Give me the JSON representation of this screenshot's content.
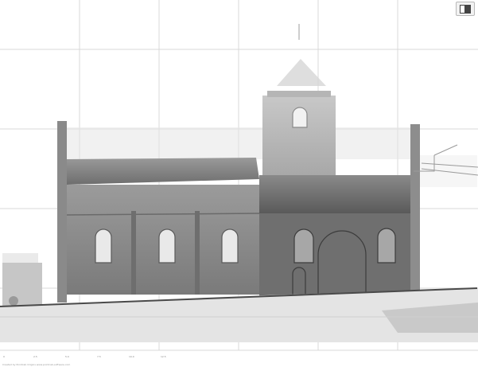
{
  "viewer": {
    "background": "#ffffff",
    "grid_color": "#d9d9d9",
    "grid_columns": 6,
    "grid_rows": 5
  },
  "toolbar": {
    "view_button_icon": "book-view-icon"
  },
  "scan": {
    "subject": "church-elevation-pointcloud",
    "tone_dark": "#5f5f5f",
    "tone_mid": "#8e8e8e",
    "tone_light": "#c9c9c9"
  },
  "scale": {
    "ticks": [
      "0",
      "2.5",
      "5.0",
      "7.5",
      "10.0",
      "12.5"
    ]
  },
  "footer": {
    "credit": "Created by Pointcab Origins www.pointcab-software.com"
  }
}
